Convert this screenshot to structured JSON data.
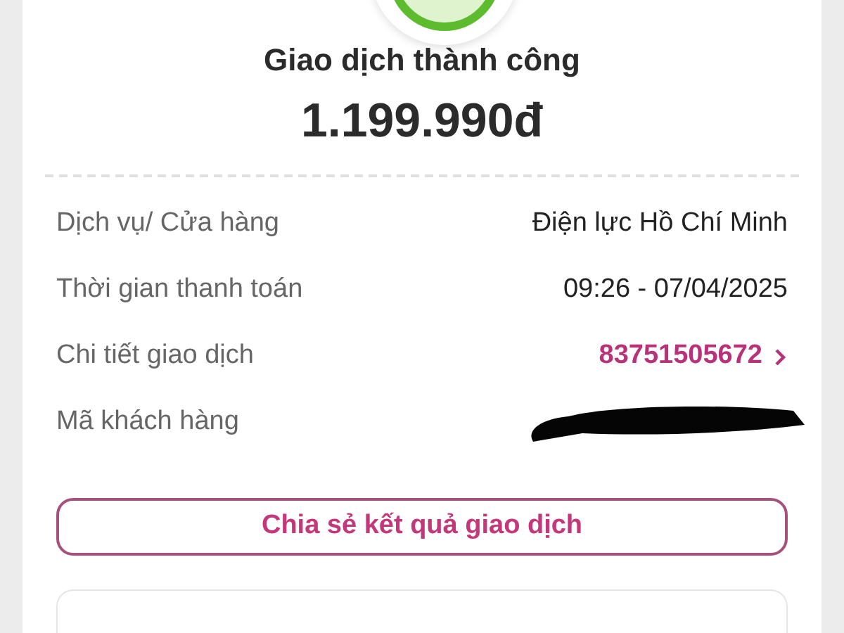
{
  "status": {
    "title": "Giao dịch thành công",
    "amount": "1.199.990đ"
  },
  "details": [
    {
      "label": "Dịch vụ/ Cửa hàng",
      "value": "Điện lực Hồ Chí Minh",
      "kind": "text"
    },
    {
      "label": "Thời gian thanh toán",
      "value": "09:26 - 07/04/2025",
      "kind": "text"
    },
    {
      "label": "Chi tiết giao dịch",
      "value": "83751505672",
      "kind": "link"
    },
    {
      "label": "Mã khách hàng",
      "kind": "redacted"
    }
  ],
  "share_button": "Chia sẻ kết quả giao dịch"
}
